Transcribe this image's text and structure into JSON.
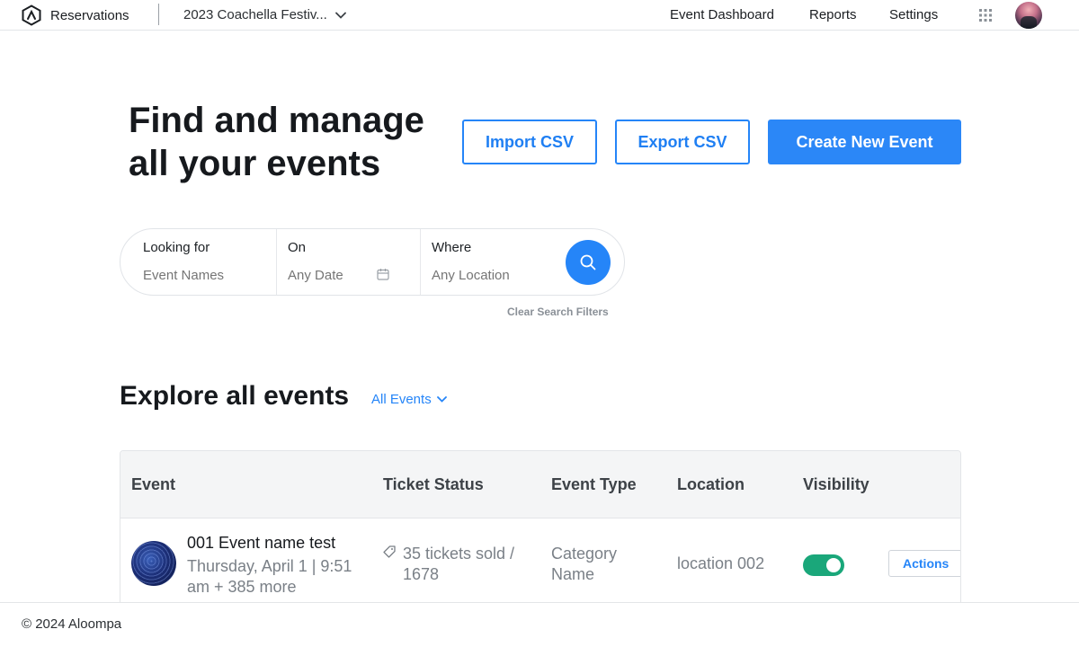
{
  "topbar": {
    "app_name": "Reservations",
    "festival": "2023 Coachella Festiv...",
    "nav": [
      "Event Dashboard",
      "Reports",
      "Settings"
    ]
  },
  "hero": {
    "title_line1": "Find and manage",
    "title_line2": "all your events",
    "import_label": "Import CSV",
    "export_label": "Export CSV",
    "create_label": "Create New Event"
  },
  "search": {
    "looking_for_label": "Looking for",
    "looking_for_placeholder": "Event Names",
    "on_label": "On",
    "on_placeholder": "Any Date",
    "where_label": "Where",
    "where_placeholder": "Any Location",
    "clear_label": "Clear Search Filters"
  },
  "explore": {
    "title": "Explore all events",
    "filter": "All Events"
  },
  "table": {
    "headers": [
      "Event",
      "Ticket Status",
      "Event Type",
      "Location",
      "Visibility"
    ],
    "rows": [
      {
        "name": "001 Event name test",
        "date": "Thursday, April 1 | 9:51 am + 385 more",
        "tickets": "35 tickets sold / 1678",
        "type": "Category Name",
        "location": "location 002",
        "visible": true,
        "actions": "Actions"
      }
    ]
  },
  "footer": {
    "text": "© 2024 Aloompa"
  },
  "colors": {
    "accent": "#2585f8",
    "toggle_on": "#1aa77a"
  },
  "icons": [
    "brand-logo-icon",
    "chevron-down-icon",
    "apps-grid-icon",
    "calendar-icon",
    "search-icon",
    "ticket-icon"
  ]
}
